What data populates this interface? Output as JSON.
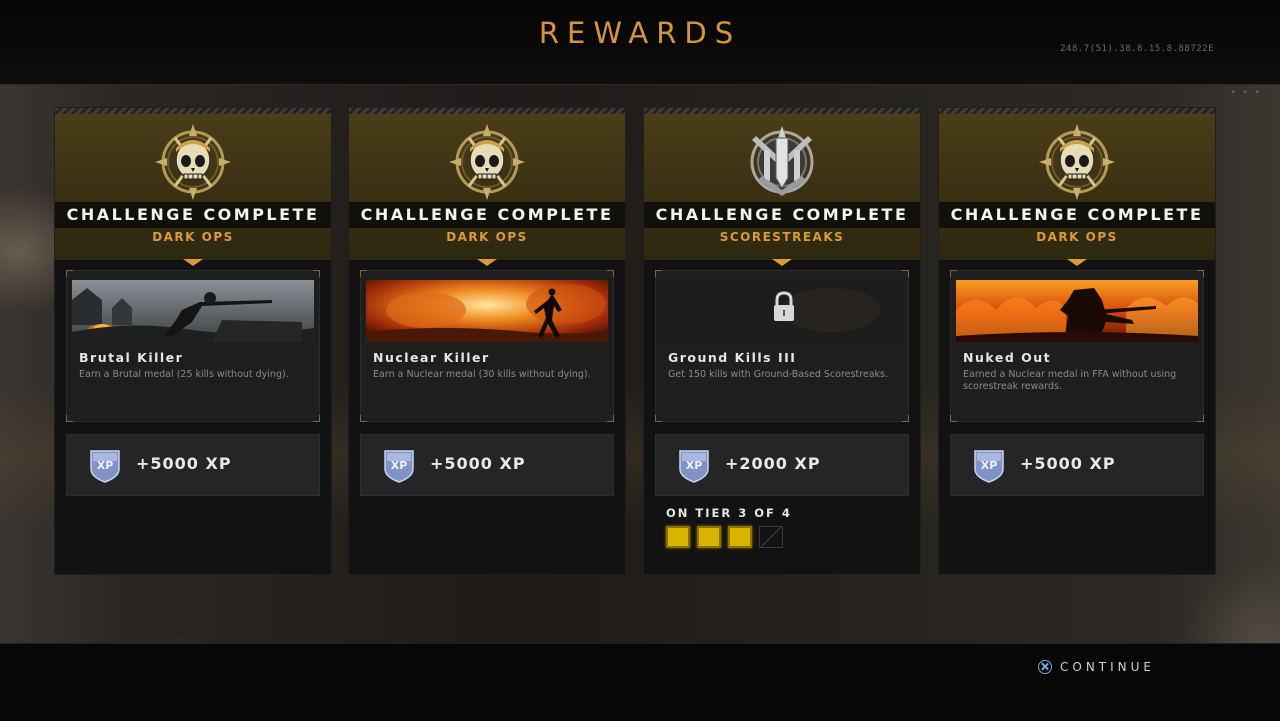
{
  "header": {
    "title": "REWARDS",
    "build": "248.7(51).38.8.15.8.88722E"
  },
  "cards": [
    {
      "heading": "CHALLENGE COMPLETE",
      "category": "DARK OPS",
      "emblem": "skull-emblem-icon",
      "name": "Brutal Killer",
      "description": "Earn a Brutal medal (25 kills without dying).",
      "xp": "+5000 XP",
      "image": "soldier-sniper-scene"
    },
    {
      "heading": "CHALLENGE COMPLETE",
      "category": "DARK OPS",
      "emblem": "skull-emblem-icon",
      "name": "Nuclear Killer",
      "description": "Earn a Nuclear medal (30 kills without dying).",
      "xp": "+5000 XP",
      "image": "nuclear-explosion-scene"
    },
    {
      "heading": "CHALLENGE COMPLETE",
      "category": "SCORESTREAKS",
      "emblem": "missile-emblem-icon",
      "name": "Ground Kills III",
      "description": "Get 150 kills with Ground-Based Scorestreaks.",
      "xp": "+2000 XP",
      "image": "locked-scene",
      "tier": {
        "label": "ON TIER 3 OF 4",
        "current": 3,
        "total": 4
      }
    },
    {
      "heading": "CHALLENGE COMPLETE",
      "category": "DARK OPS",
      "emblem": "skull-emblem-icon",
      "name": "Nuked Out",
      "description": "Earned a Nuclear medal in FFA without using scorestreak rewards.",
      "xp": "+5000 XP",
      "image": "fire-soldier-scene"
    }
  ],
  "footer": {
    "continue_label": "CONTINUE",
    "button_icon": "cross-button-icon"
  },
  "colors": {
    "accent": "#d7943e",
    "tier_on": "#d8b400",
    "xp_shield": "#7f93c6"
  }
}
